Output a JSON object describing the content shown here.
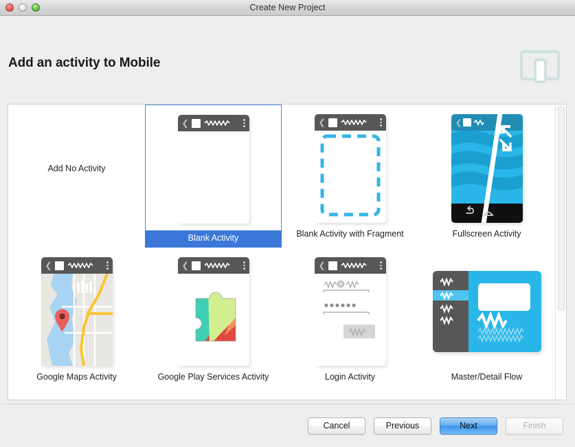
{
  "window": {
    "title": "Create New Project",
    "traffic_lights": [
      "close-red",
      "minimize-gray",
      "zoom-green"
    ]
  },
  "header": {
    "page_title": "Add an activity to Mobile",
    "device_icon": "tablet-phone-icon",
    "device_icon_color": "#cfe2e0"
  },
  "colors": {
    "selection_blue": "#3b78d8",
    "selection_border": "#4a8fe0",
    "window_bg": "#eeeeee",
    "panel_bg": "#ffffff",
    "actionbar_gray": "#575757",
    "accent_cyan": "#29b6e8",
    "primary_button_blue": "#3d95ec"
  },
  "activities": [
    {
      "label": "Add No Activity",
      "thumb": "none",
      "selected": false
    },
    {
      "label": "Blank Activity",
      "thumb": "blank",
      "selected": true
    },
    {
      "label": "Blank Activity with Fragment",
      "thumb": "blank-fragment",
      "selected": false
    },
    {
      "label": "Fullscreen Activity",
      "thumb": "fullscreen",
      "selected": false
    },
    {
      "label": "Google Maps Activity",
      "thumb": "maps",
      "selected": false
    },
    {
      "label": "Google Play Services Activity",
      "thumb": "play-services",
      "selected": false
    },
    {
      "label": "Login Activity",
      "thumb": "login",
      "selected": false
    },
    {
      "label": "Master/Detail Flow",
      "thumb": "master-detail",
      "selected": false
    }
  ],
  "scrollbar": {
    "orientation": "vertical",
    "thumb_fraction": 0.69
  },
  "buttons": {
    "cancel": "Cancel",
    "previous": "Previous",
    "next": "Next",
    "finish": "Finish",
    "next_is_default": true,
    "finish_disabled": true
  }
}
